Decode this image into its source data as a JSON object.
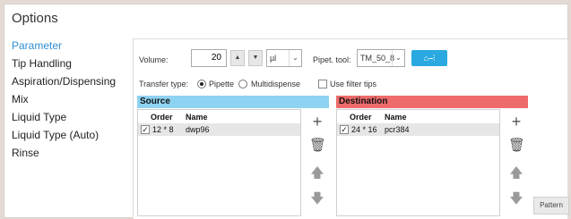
{
  "window": {
    "title": "Options"
  },
  "nav": {
    "items": [
      {
        "label": "Parameter",
        "active": true
      },
      {
        "label": "Tip Handling"
      },
      {
        "label": "Aspiration/Dispensing"
      },
      {
        "label": "Mix"
      },
      {
        "label": "Liquid Type"
      },
      {
        "label": "Liquid Type (Auto)"
      },
      {
        "label": "Rinse"
      }
    ]
  },
  "params": {
    "volume_label": "Volume:",
    "volume_value": "20",
    "unit": "µl",
    "pipet_label": "Pipet. tool:",
    "pipet_value": "TM_50_8",
    "tool_icon": "pipette-multichannel-icon",
    "transfer_label": "Transfer type:",
    "opt_pipette": "Pipette",
    "opt_multi": "Multidispense",
    "filter_label": "Use filter tips"
  },
  "source": {
    "header": "Source",
    "col_order": "Order",
    "col_name": "Name",
    "rows": [
      {
        "order": "12 * 8",
        "name": "dwp96"
      }
    ],
    "color": "#8fd3f2"
  },
  "destination": {
    "header": "Destination",
    "col_order": "Order",
    "col_name": "Name",
    "rows": [
      {
        "order": "24 * 16",
        "name": "pcr384"
      }
    ],
    "color": "#ee6b6b"
  },
  "buttons": {
    "pattern": "Pattern"
  }
}
